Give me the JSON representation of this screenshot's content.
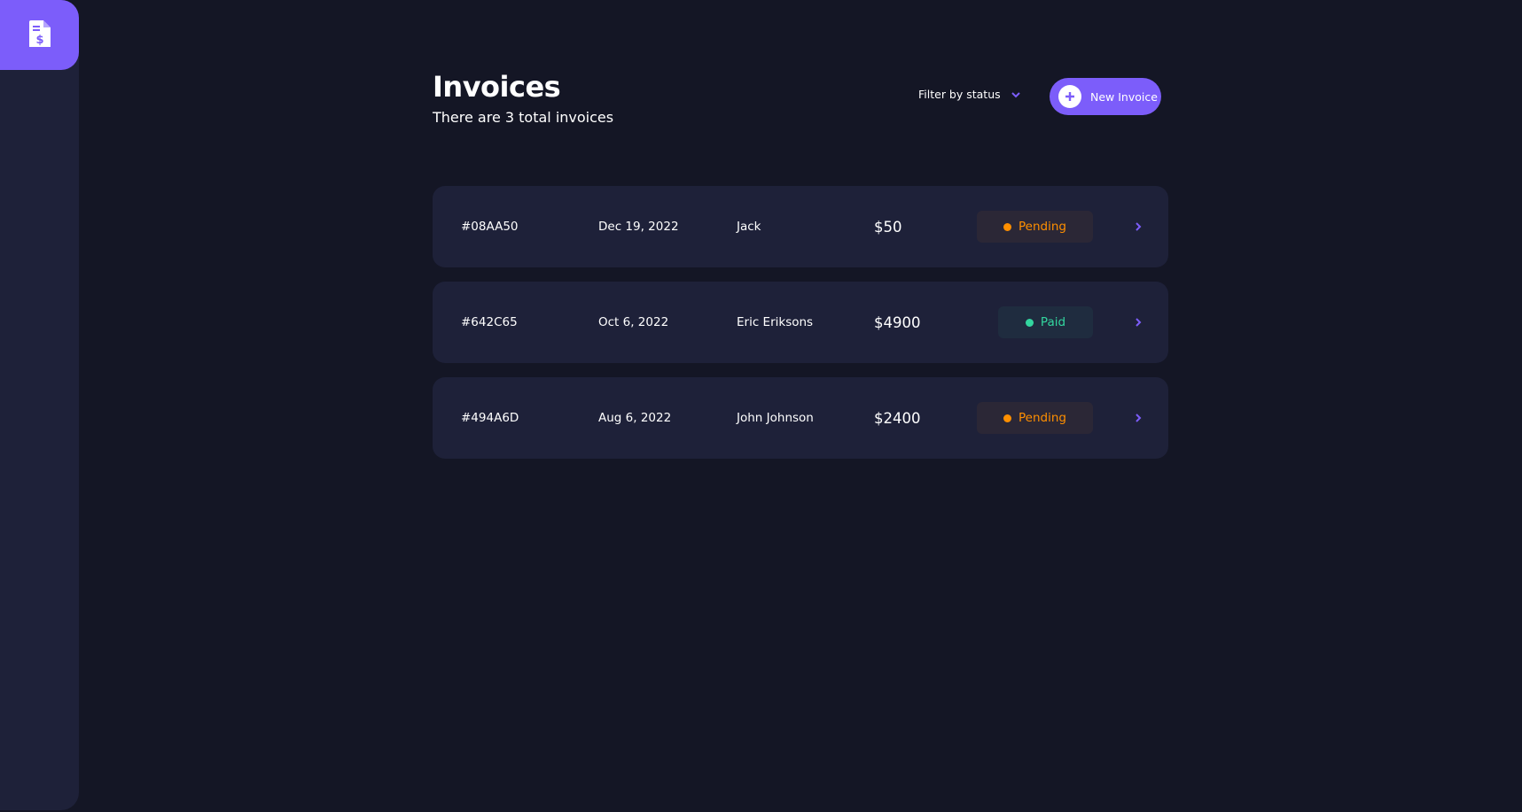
{
  "page": {
    "title": "Invoices",
    "subtitle": "There are 3 total invoices"
  },
  "sidebar": {
    "logo_icon": "invoice-dollar-icon"
  },
  "toolbar": {
    "filter_label": "Filter by status",
    "filter_icon": "chevron-down-icon",
    "new_button_label": "New Invoice",
    "new_button_icon": "plus-icon"
  },
  "colors": {
    "background": "#141625",
    "surface": "#1e2139",
    "accent": "#7c5dfa",
    "pending": "#ff8f00",
    "pending_bg": "#2b2736",
    "paid": "#33d69f",
    "paid_bg": "#1f2c3f"
  },
  "invoices": [
    {
      "id": "#08AA50",
      "date": "Dec 19, 2022",
      "name": "Jack",
      "amount": "$50",
      "status": "Pending",
      "status_key": "pending"
    },
    {
      "id": "#642C65",
      "date": "Oct 6, 2022",
      "name": "Eric Eriksons",
      "amount": "$4900",
      "status": "Paid",
      "status_key": "paid"
    },
    {
      "id": "#494A6D",
      "date": "Aug 6, 2022",
      "name": "John Johnson",
      "amount": "$2400",
      "status": "Pending",
      "status_key": "pending"
    }
  ]
}
